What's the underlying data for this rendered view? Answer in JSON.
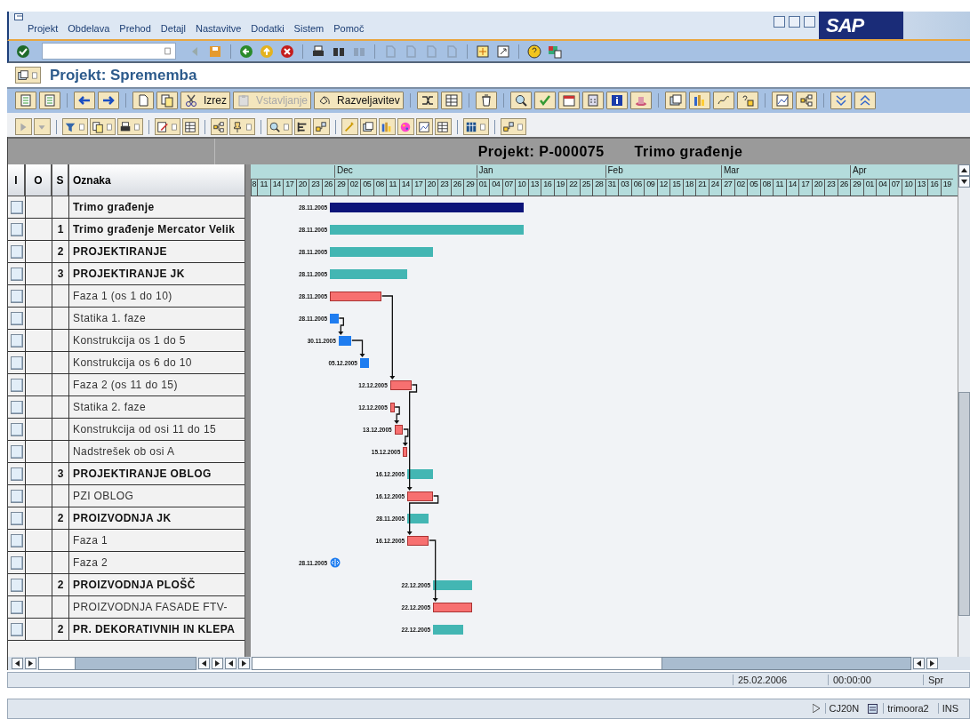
{
  "menu": {
    "items": [
      "Projekt",
      "Obdelava",
      "Prehod",
      "Detajl",
      "Nastavitve",
      "Dodatki",
      "Sistem",
      "Pomoč"
    ]
  },
  "logo": "SAP",
  "title": "Projekt: Sprememba",
  "app_toolbar": {
    "buttons": [
      {
        "label": "Izrez",
        "disabled": false
      },
      {
        "label": "Vstavljanje",
        "disabled": true
      },
      {
        "label": "Razveljavitev",
        "disabled": false
      }
    ]
  },
  "gantt": {
    "title": "Projekt: P-000075",
    "subtitle": "Trimo građenje",
    "columns": [
      "I",
      "O",
      "S",
      "Oznaka"
    ],
    "ticks": [
      "8",
      "11",
      "14",
      "17",
      "20",
      "23",
      "26",
      "29",
      "02",
      "05",
      "08",
      "11",
      "14",
      "17",
      "20",
      "23",
      "26",
      "29",
      "01",
      "04",
      "07",
      "10",
      "13",
      "16",
      "19",
      "22",
      "25",
      "28",
      "31",
      "03",
      "06",
      "09",
      "12",
      "15",
      "18",
      "21",
      "24",
      "27",
      "02",
      "05",
      "08",
      "11",
      "14",
      "17",
      "20",
      "23",
      "26",
      "29",
      "01",
      "04",
      "07",
      "10",
      "13",
      "16",
      "19"
    ],
    "months": [
      {
        "label": "Dec"
      },
      {
        "label": "Jan"
      },
      {
        "label": "Feb"
      },
      {
        "label": "Mar"
      },
      {
        "label": "Apr"
      }
    ],
    "rows": [
      {
        "label": "Trimo građenje",
        "bold": true,
        "selected": false,
        "bar": {
          "kind": "summary",
          "date_label": "28.11.2005"
        }
      },
      {
        "mark": "1",
        "label": "Trimo građenje Mercator Velik",
        "bold": true,
        "selected": false,
        "bar": {
          "kind": "plan",
          "date_label": "28.11.2005"
        }
      },
      {
        "mark": "2",
        "label": "PROJEKTIRANJE",
        "bold": true,
        "selected": false,
        "bar": {
          "kind": "plan",
          "date_label": "28.11.2005"
        }
      },
      {
        "mark": "3",
        "label": "PROJEKTIRANJE JK",
        "bold": true,
        "selected": false,
        "bar": {
          "kind": "plan",
          "date_label": "28.11.2005"
        }
      },
      {
        "label": "Faza 1 (os 1 do 10)",
        "bold": false,
        "selected": false,
        "bar": {
          "kind": "actual",
          "date_label": "28.11.2005"
        }
      },
      {
        "label": "Statika 1. faze",
        "bold": false,
        "selected": false,
        "bar": {
          "kind": "task",
          "date_label": "28.11.2005"
        }
      },
      {
        "label": "Konstrukcija os 1 do 5",
        "bold": false,
        "selected": false,
        "bar": {
          "kind": "task",
          "date_label": "30.11.2005"
        }
      },
      {
        "label": "Konstrukcija os 6 do 10",
        "bold": false,
        "selected": false,
        "bar": {
          "kind": "task",
          "date_label": "05.12.2005"
        }
      },
      {
        "label": "Faza 2 (os 11 do 15)",
        "bold": false,
        "selected": false,
        "bar": {
          "kind": "actual",
          "date_label": "12.12.2005"
        }
      },
      {
        "label": "Statika 2. faze",
        "bold": false,
        "selected": false,
        "bar": {
          "kind": "actual",
          "date_label": "12.12.2005"
        }
      },
      {
        "label": "Konstrukcija od osi 11 do 15",
        "bold": false,
        "selected": false,
        "bar": {
          "kind": "actual",
          "date_label": "13.12.2005"
        }
      },
      {
        "label": "Nadstrešek ob osi A",
        "bold": false,
        "selected": false,
        "bar": {
          "kind": "actual",
          "date_label": "15.12.2005"
        }
      },
      {
        "mark": "3",
        "label": "PROJEKTIRANJE  OBLOG",
        "bold": true,
        "selected": false,
        "bar": {
          "kind": "plan",
          "date_label": "16.12.2005"
        }
      },
      {
        "label": "PZI OBLOG",
        "bold": false,
        "selected": false,
        "bar": {
          "kind": "actual",
          "date_label": "16.12.2005"
        }
      },
      {
        "mark": "2",
        "label": "PROIZVODNJA  JK",
        "bold": true,
        "selected": false,
        "bar": {
          "kind": "plan",
          "date_label": "28.11.2005"
        }
      },
      {
        "label": "Faza 1",
        "bold": false,
        "selected": false,
        "bar": {
          "kind": "actual",
          "date_label": "16.12.2005"
        }
      },
      {
        "label": "Faza 2",
        "bold": false,
        "selected": false,
        "bar": {
          "kind": "milestone",
          "date_label": "28.11.2005"
        }
      },
      {
        "mark": "2",
        "label": "PROIZVODNJA PLOŠČ",
        "bold": true,
        "selected": false,
        "bar": {
          "kind": "plan",
          "date_label": "22.12.2005"
        }
      },
      {
        "label": "PROIZVODNJA FASADE FTV-",
        "bold": false,
        "selected": false,
        "bar": {
          "kind": "actual",
          "date_label": "22.12.2005"
        }
      },
      {
        "mark": "2",
        "label": "PR. DEKORATIVNIH IN KLEPA",
        "bold": true,
        "selected": false,
        "bar": {
          "kind": "plan",
          "date_label": "22.12.2005"
        }
      }
    ]
  },
  "status": {
    "date": "25.02.2006",
    "time": "00:00:00",
    "mode": "Spr"
  },
  "system_status": {
    "transaction": "CJ20N",
    "user": "trimoora2",
    "insert_mode": "INS"
  }
}
